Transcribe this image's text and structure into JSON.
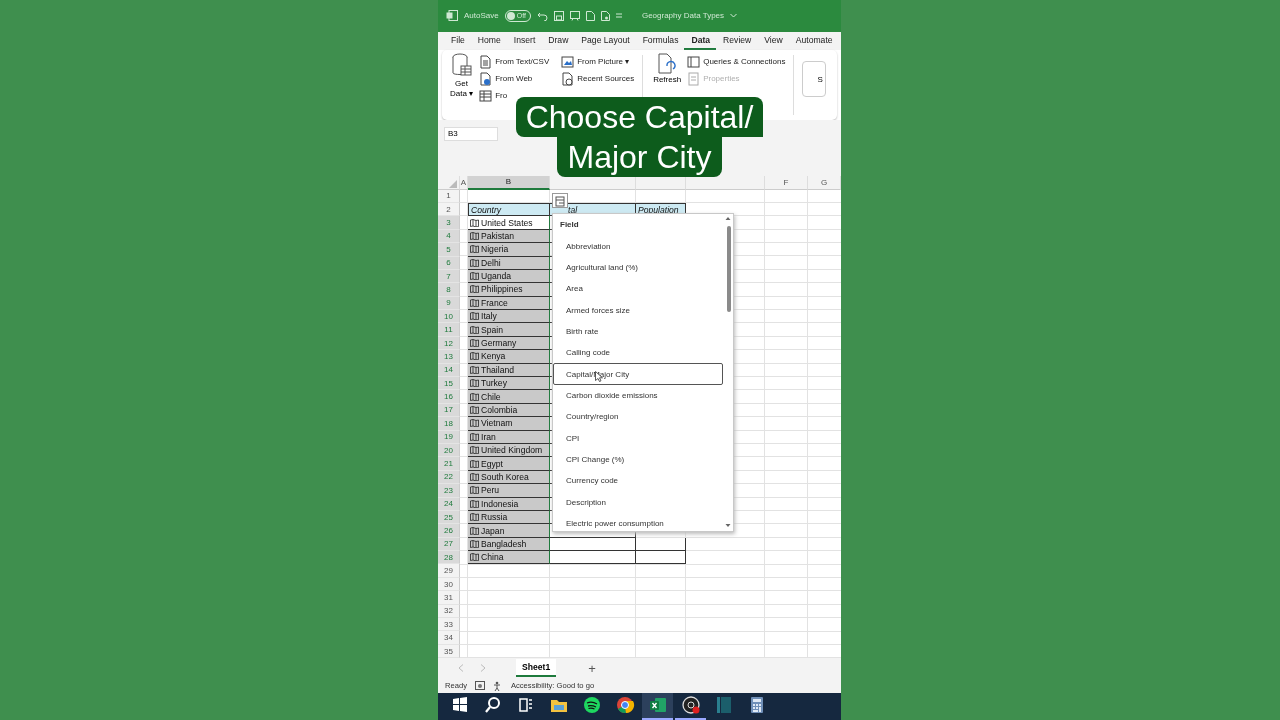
{
  "title_bar": {
    "autosave_label": "AutoSave",
    "autosave_toggle": {
      "label": "Off",
      "on": false
    },
    "document_title": "Geography Data Types"
  },
  "menu_tabs": [
    {
      "label": "File",
      "selected": false
    },
    {
      "label": "Home",
      "selected": false
    },
    {
      "label": "Insert",
      "selected": false
    },
    {
      "label": "Draw",
      "selected": false
    },
    {
      "label": "Page Layout",
      "selected": false
    },
    {
      "label": "Formulas",
      "selected": false
    },
    {
      "label": "Data",
      "selected": true
    },
    {
      "label": "Review",
      "selected": false
    },
    {
      "label": "View",
      "selected": false
    },
    {
      "label": "Automate",
      "selected": false
    }
  ],
  "ribbon": {
    "get_data": [
      "Get",
      "Data ▾"
    ],
    "import_buttons": [
      {
        "label": "From Text/CSV",
        "kind": "text"
      },
      {
        "label": "From Web",
        "kind": "web"
      },
      {
        "label": "Fro",
        "kind": "table"
      }
    ],
    "source_buttons": [
      {
        "label": "From Picture ▾",
        "kind": "picture"
      },
      {
        "label": "Recent Sources",
        "kind": "recent"
      }
    ],
    "refresh": [
      "Refresh"
    ],
    "query_buttons": [
      {
        "label": "Queries & Connections",
        "kind": "queries",
        "disabled": false
      },
      {
        "label": "Properties",
        "kind": "properties",
        "disabled": true
      }
    ],
    "partial_button": "S"
  },
  "name_box": "B3",
  "caption": [
    "Choose Capital/",
    "Major City"
  ],
  "sheet": {
    "columns": [
      {
        "label": "A",
        "selected": false
      },
      {
        "label": "B",
        "selected": true
      },
      {
        "selected": false
      },
      {
        "selected": false
      },
      {
        "selected": false
      },
      {
        "label": "F",
        "selected": false
      },
      {
        "label": "G",
        "selected": false
      }
    ],
    "header_cells": [
      "Country",
      "tal",
      "Population"
    ],
    "countries": [
      {
        "name": "United States",
        "active": true
      },
      {
        "name": "Pakistan",
        "active": false
      },
      {
        "name": "Nigeria",
        "active": false
      },
      {
        "name": "Delhi",
        "active": false
      },
      {
        "name": "Uganda",
        "active": false
      },
      {
        "name": "Philippines",
        "active": false
      },
      {
        "name": "France",
        "active": false
      },
      {
        "name": "Italy",
        "active": false
      },
      {
        "name": "Spain",
        "active": false
      },
      {
        "name": "Germany",
        "active": false
      },
      {
        "name": "Kenya",
        "active": false
      },
      {
        "name": "Thailand",
        "active": false
      },
      {
        "name": "Turkey",
        "active": false
      },
      {
        "name": "Chile",
        "active": false
      },
      {
        "name": "Colombia",
        "active": false
      },
      {
        "name": "Vietnam",
        "active": false
      },
      {
        "name": "Iran",
        "active": false
      },
      {
        "name": "United Kingdom",
        "active": false
      },
      {
        "name": "Egypt",
        "active": false
      },
      {
        "name": "South Korea",
        "active": false
      },
      {
        "name": "Peru",
        "active": false
      },
      {
        "name": "Indonesia",
        "active": false
      },
      {
        "name": "Russia",
        "active": false
      },
      {
        "name": "Japan",
        "active": false
      },
      {
        "name": "Bangladesh",
        "active": false
      },
      {
        "name": "China",
        "active": false
      }
    ],
    "row_numbers": [
      "1",
      "2",
      "3",
      "4",
      "5",
      "6",
      "7",
      "8",
      "9",
      "10",
      "11",
      "12",
      "13",
      "14",
      "15",
      "16",
      "17",
      "18",
      "19",
      "20",
      "21",
      "22",
      "23",
      "24",
      "25",
      "26",
      "27",
      "28",
      "29",
      "30",
      "31",
      "32",
      "33",
      "34",
      "35"
    ]
  },
  "dropdown": {
    "header": "Field",
    "items": [
      {
        "label": "Abbreviation",
        "selected": false
      },
      {
        "label": "Agricultural land (%)",
        "selected": false
      },
      {
        "label": "Area",
        "selected": false
      },
      {
        "label": "Armed forces size",
        "selected": false
      },
      {
        "label": "Birth rate",
        "selected": false
      },
      {
        "label": "Calling code",
        "selected": false
      },
      {
        "label": "Capital/Major City",
        "selected": true
      },
      {
        "label": "Carbon dioxide emissions",
        "selected": false
      },
      {
        "label": "Country/region",
        "selected": false
      },
      {
        "label": "CPI",
        "selected": false
      },
      {
        "label": "CPI Change (%)",
        "selected": false
      },
      {
        "label": "Currency code",
        "selected": false
      },
      {
        "label": "Description",
        "selected": false
      },
      {
        "label": "Electric power consumption",
        "selected": false
      }
    ]
  },
  "sheet_tabs": [
    {
      "label": "Sheet1",
      "selected": true
    }
  ],
  "add_sheet": "+",
  "status_bar": {
    "ready": "Ready",
    "accessibility": "Accessibility: Good to go"
  },
  "taskbar": [
    {
      "kind": "start",
      "selected": false,
      "open": false
    },
    {
      "kind": "search",
      "selected": false,
      "open": false
    },
    {
      "kind": "taskview",
      "selected": false,
      "open": false
    },
    {
      "kind": "folder",
      "selected": false,
      "open": false
    },
    {
      "kind": "music",
      "selected": false,
      "open": false
    },
    {
      "kind": "browser",
      "selected": false,
      "open": false
    },
    {
      "kind": "sheet",
      "selected": true,
      "open": true
    },
    {
      "kind": "recorder",
      "selected": false,
      "open": true
    },
    {
      "kind": "panel",
      "selected": false,
      "open": false
    },
    {
      "kind": "calculator",
      "selected": false,
      "open": false
    }
  ]
}
